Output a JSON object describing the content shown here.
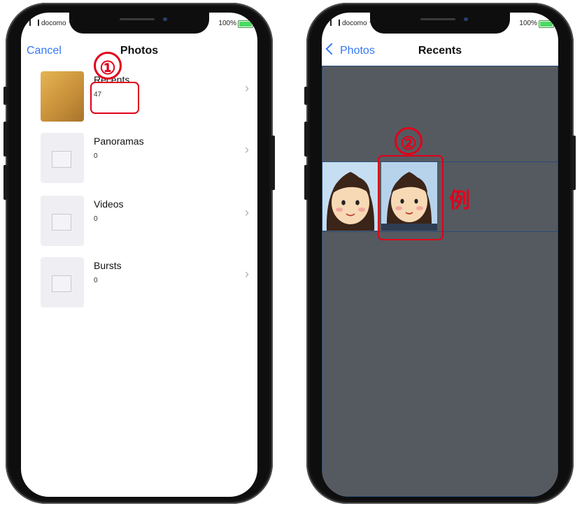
{
  "left_phone": {
    "status": {
      "carrier": "docomo",
      "battery": "100%"
    },
    "nav": {
      "cancel": "Cancel",
      "title": "Photos"
    },
    "albums": [
      {
        "name": "Recents",
        "count": "47"
      },
      {
        "name": "Panoramas",
        "count": "0"
      },
      {
        "name": "Videos",
        "count": "0"
      },
      {
        "name": "Bursts",
        "count": "0"
      }
    ],
    "marker": "①"
  },
  "right_phone": {
    "status": {
      "carrier": "docomo",
      "battery": "100%"
    },
    "nav": {
      "back": "Photos",
      "title": "Recents"
    },
    "marker": "②",
    "example_label": "例"
  },
  "colors": {
    "accent_blue": "#3478f6",
    "annotation_red": "#e0001a",
    "grid_background": "#555a60"
  }
}
